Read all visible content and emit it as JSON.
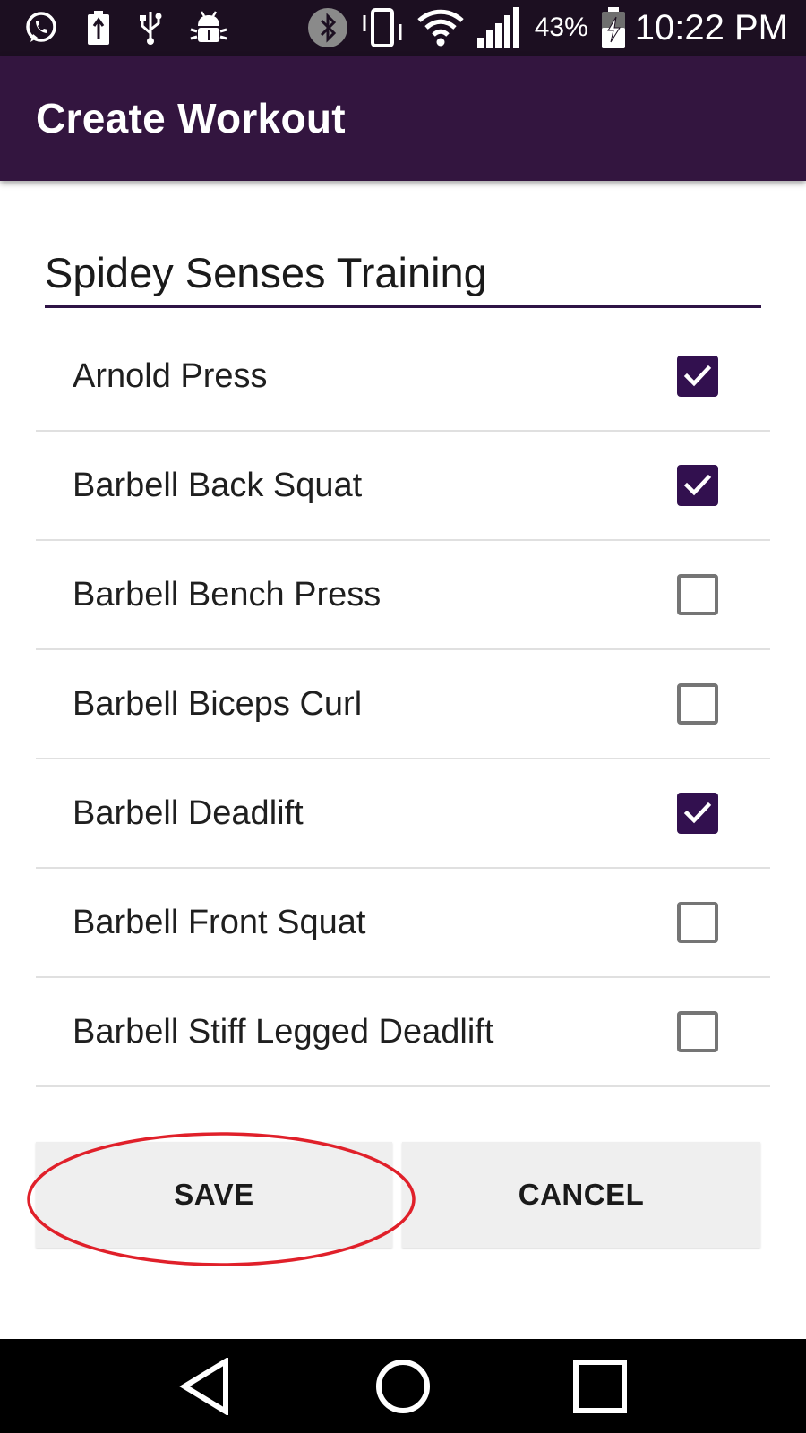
{
  "status_bar": {
    "battery_percent": "43%",
    "time": "10:22 PM",
    "icons": [
      "whatsapp-icon",
      "battery-saver-icon",
      "usb-icon",
      "android-debug-icon",
      "bluetooth-icon",
      "vibrate-icon",
      "wifi-icon",
      "signal-icon",
      "battery-charging-icon"
    ]
  },
  "app_bar": {
    "title": "Create Workout"
  },
  "workout_name": {
    "value": "Spidey Senses Training"
  },
  "exercises": [
    {
      "label": "Arnold Press",
      "checked": true
    },
    {
      "label": "Barbell Back Squat",
      "checked": true
    },
    {
      "label": "Barbell Bench Press",
      "checked": false
    },
    {
      "label": "Barbell Biceps Curl",
      "checked": false
    },
    {
      "label": "Barbell Deadlift",
      "checked": true
    },
    {
      "label": "Barbell Front Squat",
      "checked": false
    },
    {
      "label": "Barbell Stiff Legged Deadlift",
      "checked": false
    }
  ],
  "buttons": {
    "save": "SAVE",
    "cancel": "CANCEL"
  },
  "colors": {
    "status_bar": "#1c0f21",
    "app_bar": "#33153f",
    "accent": "#32104f",
    "highlight_ring": "#e0202a",
    "button_bg": "#efefef"
  },
  "nav_bar": {
    "icons": [
      "back-icon",
      "home-icon",
      "recents-icon"
    ]
  }
}
